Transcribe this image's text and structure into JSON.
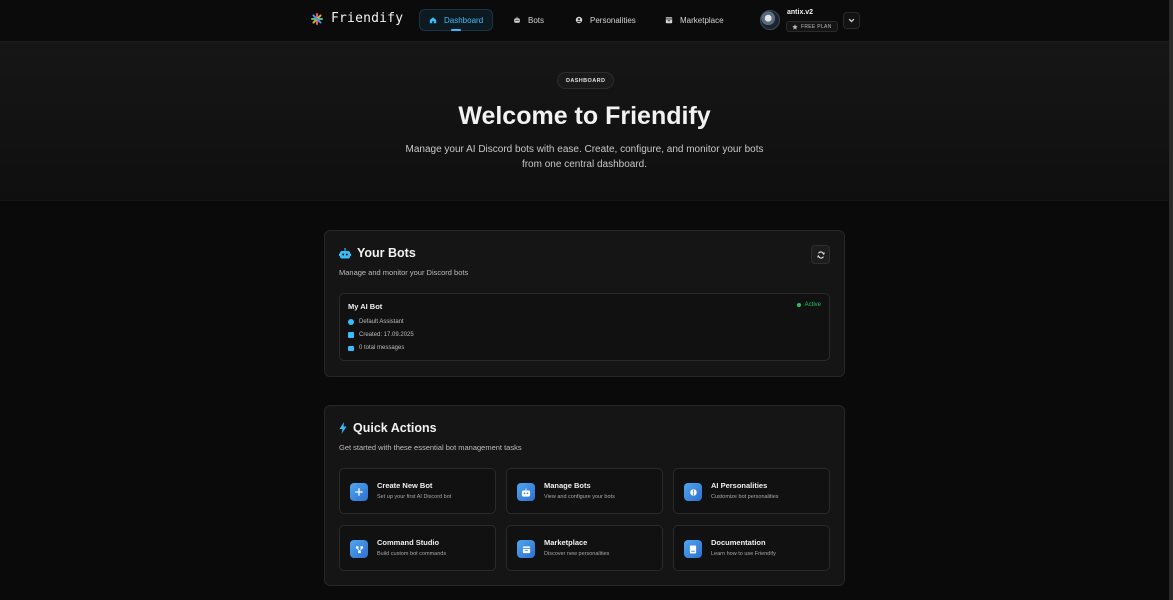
{
  "brand": {
    "name": "Friendify"
  },
  "nav": {
    "items": [
      {
        "label": "Dashboard",
        "icon": "home-icon",
        "active": true
      },
      {
        "label": "Bots",
        "icon": "bot-icon",
        "active": false
      },
      {
        "label": "Personalities",
        "icon": "user-icon",
        "active": false
      },
      {
        "label": "Marketplace",
        "icon": "store-icon",
        "active": false
      }
    ]
  },
  "user": {
    "name": "antix.v2",
    "plan": "FREE PLAN"
  },
  "hero": {
    "badge": "DASHBOARD",
    "title": "Welcome to Friendify",
    "subtitle": "Manage your AI Discord bots with ease. Create, configure, and monitor your bots from one central dashboard."
  },
  "bots_card": {
    "title": "Your Bots",
    "subtitle": "Manage and monitor your Discord bots",
    "bots": [
      {
        "name": "My AI Bot",
        "status": "Active",
        "personality": "Default Assistant",
        "created": "Created: 17.09.2025",
        "messages": "0 total messages"
      }
    ]
  },
  "quick_actions": {
    "title": "Quick Actions",
    "subtitle": "Get started with these essential bot management tasks",
    "items": [
      {
        "title": "Create New Bot",
        "desc": "Set up your first AI Discord bot",
        "icon": "plus-icon"
      },
      {
        "title": "Manage Bots",
        "desc": "View and configure your bots",
        "icon": "bot-icon"
      },
      {
        "title": "AI Personalities",
        "desc": "Customize bot personalities",
        "icon": "brain-icon"
      },
      {
        "title": "Command Studio",
        "desc": "Build custom bot commands",
        "icon": "workflow-icon"
      },
      {
        "title": "Marketplace",
        "desc": "Discover new personalities",
        "icon": "store-icon"
      },
      {
        "title": "Documentation",
        "desc": "Learn how to use Friendify",
        "icon": "book-icon"
      }
    ]
  },
  "colors": {
    "accent": "#38bdf8",
    "active_status": "#22c55e",
    "background": "#0a0a0a"
  }
}
